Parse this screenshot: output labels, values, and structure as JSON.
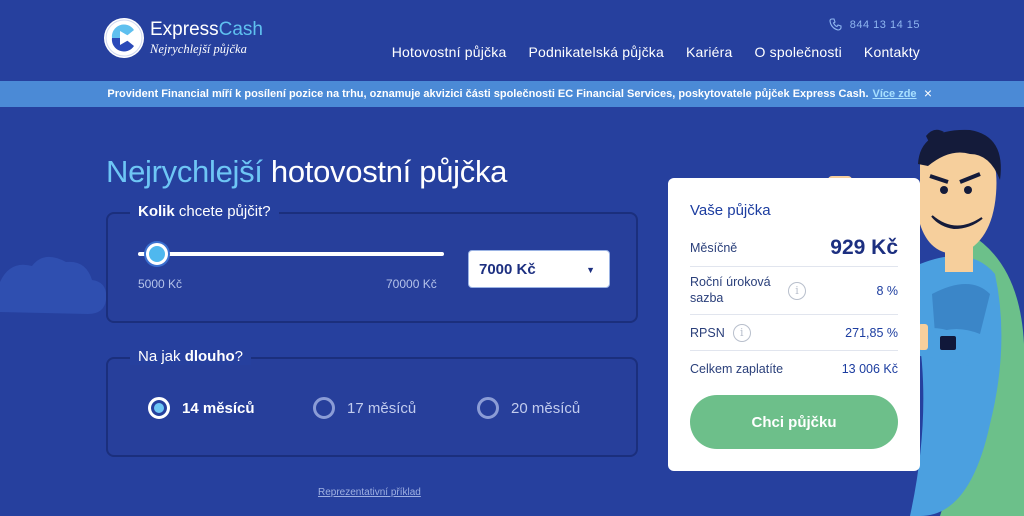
{
  "header": {
    "logo_name_1": "Express",
    "logo_name_2": "Cash",
    "logo_tagline": "Nejrychlejší půjčka",
    "phone": "844 13 14 15",
    "nav": [
      "Hotovostní půjčka",
      "Podnikatelská půjčka",
      "Kariéra",
      "O společnosti",
      "Kontakty"
    ]
  },
  "notice": {
    "text": "Provident Financial míří k posílení pozice na trhu, oznamuje akvizici části společnosti EC Financial Services, poskytovatele půjček Express Cash.",
    "link": "Více zde",
    "close": "×"
  },
  "hero": {
    "accent": "Nejrychlejší",
    "rest": " hotovostní půjčka"
  },
  "amount": {
    "title_bold": "Kolik",
    "title_rest": " chcete půjčit?",
    "slider_min": "5000 Kč",
    "slider_max": "70000 Kč",
    "slider_fraction": 0.03,
    "selected": "7000 Kč"
  },
  "duration": {
    "title_pre": "Na jak ",
    "title_bold": "dlouho",
    "title_post": "?",
    "options": [
      "14 měsíců",
      "17 měsíců",
      "20 měsíců"
    ],
    "selected_index": 0
  },
  "rep_link": "Reprezentativní příklad",
  "card": {
    "title": "Vaše půjčka",
    "monthly_label": "Měsíčně",
    "monthly_value": "929 Kč",
    "rate_label": "Roční úroková sazba",
    "rate_value": "8 %",
    "rpsn_label": "RPSN",
    "rpsn_value": "271,85 %",
    "total_label": "Celkem zaplatíte",
    "total_value": "13 006 Kč",
    "cta": "Chci půjčku"
  },
  "colors": {
    "background": "#26409e",
    "notice_bar": "#4b8ad6",
    "accent_blue": "#6ec6f5",
    "cta_green": "#6dbf8a"
  }
}
